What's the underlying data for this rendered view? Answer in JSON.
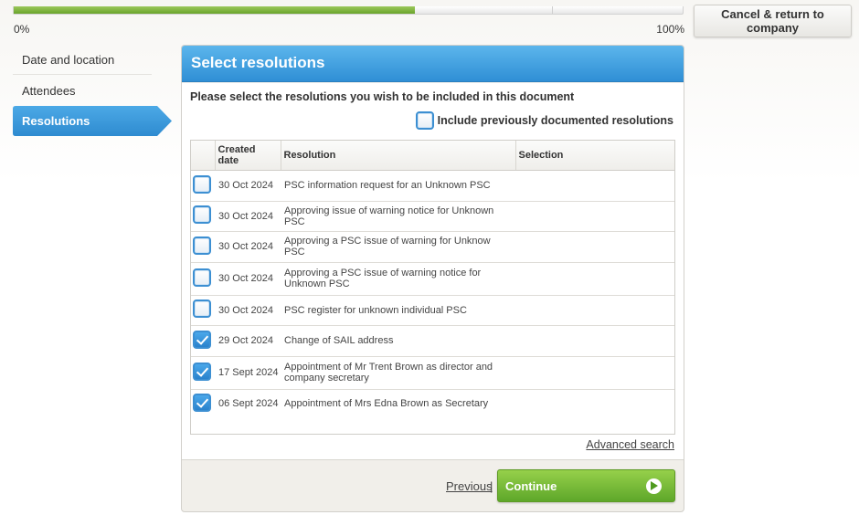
{
  "progress": {
    "value_percent": 60,
    "min_label": "0%",
    "max_label": "100%"
  },
  "header": {
    "cancel_label": "Cancel & return to company"
  },
  "sidebar": {
    "items": [
      {
        "label": "Date and location",
        "active": false
      },
      {
        "label": "Attendees",
        "active": false
      },
      {
        "label": "Resolutions",
        "active": true
      }
    ]
  },
  "panel": {
    "title": "Select resolutions",
    "instruction": "Please select the resolutions you wish to be included in this document",
    "include_previous_label": "Include previously documented resolutions",
    "include_previous_checked": false,
    "table": {
      "columns": [
        "Created date",
        "Resolution",
        "Selection"
      ],
      "rows": [
        {
          "checked": false,
          "date": "30 Oct 2024",
          "resolution": "PSC information request for an Unknown PSC",
          "selection": ""
        },
        {
          "checked": false,
          "date": "30 Oct 2024",
          "resolution": "Approving issue of warning notice for Unknown PSC",
          "selection": ""
        },
        {
          "checked": false,
          "date": "30 Oct 2024",
          "resolution": "Approving a PSC issue of warning for Unknow PSC",
          "selection": ""
        },
        {
          "checked": false,
          "date": "30 Oct 2024",
          "resolution": "Approving a PSC issue of warning notice for Unknown PSC",
          "selection": ""
        },
        {
          "checked": false,
          "date": "30 Oct 2024",
          "resolution": "PSC register for unknown individual PSC",
          "selection": ""
        },
        {
          "checked": true,
          "date": "29 Oct 2024",
          "resolution": "Change of SAIL address",
          "selection": ""
        },
        {
          "checked": true,
          "date": "17 Sept 2024",
          "resolution": "Appointment of Mr Trent Brown as director and company secretary",
          "selection": ""
        },
        {
          "checked": true,
          "date": "06 Sept 2024",
          "resolution": "Appointment of Mrs Edna Brown as Secretary",
          "selection": ""
        }
      ]
    },
    "advanced_search_label": "Advanced search"
  },
  "footer": {
    "previous_label": "Previous",
    "separator": "|",
    "continue_label": "Continue"
  },
  "colors": {
    "accent_blue": "#3a9ad9",
    "progress_green": "#7ab63a",
    "continue_green": "#6cb030"
  }
}
